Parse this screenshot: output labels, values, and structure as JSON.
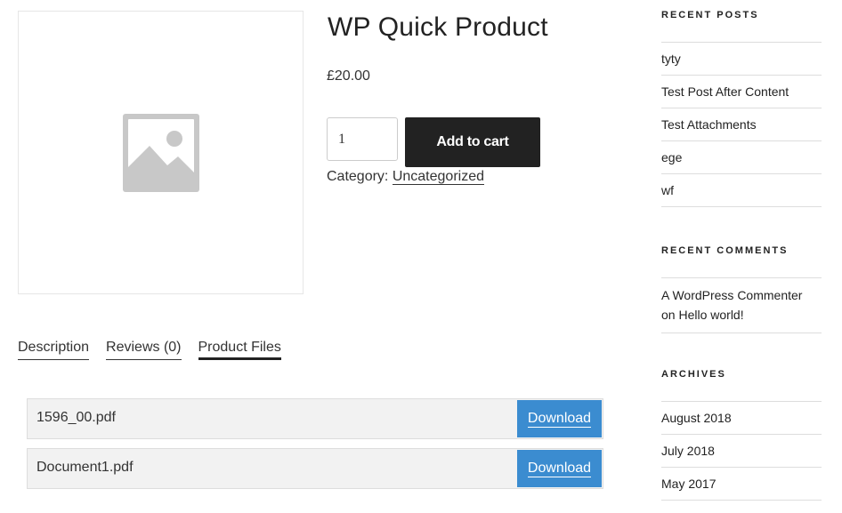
{
  "product": {
    "title": "WP Quick Product",
    "price": "£20.00",
    "quantity": "1",
    "add_to_cart_label": "Add to cart",
    "category_label": "Category:",
    "category_link": "Uncategorized",
    "image_icon": "placeholder-image-icon"
  },
  "tabs": [
    {
      "label": "Description",
      "active": false
    },
    {
      "label": "Reviews (0)",
      "active": false
    },
    {
      "label": "Product Files",
      "active": true
    }
  ],
  "files": [
    {
      "name": "1596_00.pdf",
      "action": "Download"
    },
    {
      "name": "Document1.pdf",
      "action": "Download"
    }
  ],
  "sidebar": {
    "recent_posts": {
      "title": "RECENT POSTS",
      "items": [
        "tyty",
        "Test Post After Content",
        "Test Attachments",
        "ege",
        "wf"
      ]
    },
    "recent_comments": {
      "title": "RECENT COMMENTS",
      "items": [
        {
          "author": "A WordPress Commenter",
          "on": "on",
          "post": "Hello world!"
        }
      ]
    },
    "archives": {
      "title": "ARCHIVES",
      "items": [
        "August 2018",
        "July 2018",
        "May 2017"
      ]
    }
  },
  "colors": {
    "button_dark": "#222222",
    "download_blue": "#3b8cd0",
    "file_row_bg": "#f2f2f2"
  }
}
